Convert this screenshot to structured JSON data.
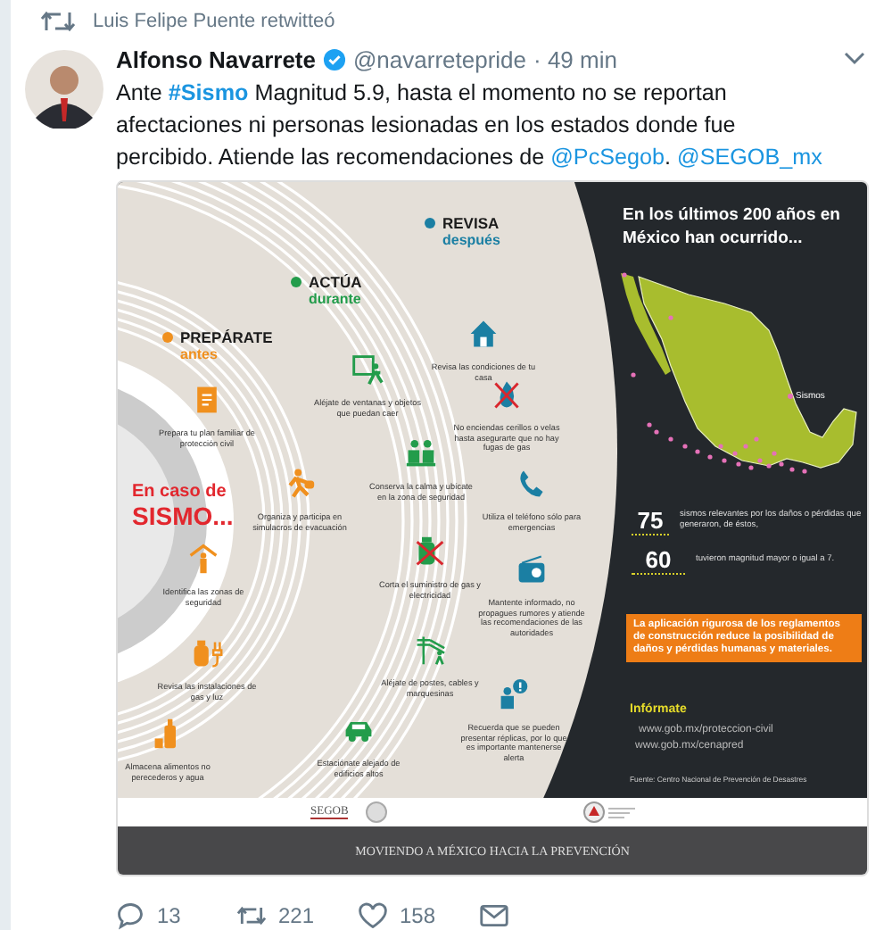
{
  "retweet_notice": "Luis Felipe Puente retwitteó",
  "tweet": {
    "author": "Alfonso Navarrete",
    "verified": true,
    "handle": "@navarretepride",
    "time": "· 49 min",
    "text": [
      {
        "kind": "plain",
        "text": "Ante "
      },
      {
        "kind": "hashtag",
        "text": "#Sismo"
      },
      {
        "kind": "plain",
        "text": " Magnitud 5.9, hasta el momento no se reportan afectaciones ni personas lesionadas en los estados donde fue percibido. Atiende las recomendaciones de "
      },
      {
        "kind": "mention",
        "text": "@PcSegob"
      },
      {
        "kind": "plain",
        "text": ". "
      },
      {
        "kind": "mention",
        "text": "@SEGOB_mx"
      }
    ]
  },
  "infographic": {
    "phases": [
      {
        "title": "PREPÁRATE",
        "subtitle": "antes",
        "color": "#f0901e"
      },
      {
        "title": "ACTÚA",
        "subtitle": "durante",
        "color": "#239c4b"
      },
      {
        "title": "REVISA",
        "subtitle": "después",
        "color": "#1b7fa3"
      }
    ],
    "headline": {
      "line_1": "En caso de",
      "line_2": "SISMO..."
    },
    "tips": [
      {
        "kind": "clipboard",
        "color": "#f0901e",
        "text": "Prepara tu plan familiar de protección civil"
      },
      {
        "kind": "runner",
        "color": "#f0901e",
        "text": "Organiza y participa en simulacros de evacuación"
      },
      {
        "kind": "shelter",
        "color": "#f0901e",
        "text": "Identifica las zonas de seguridad"
      },
      {
        "kind": "gas_plug",
        "color": "#f0901e",
        "text": "Revisa las instalaciones de gas y luz"
      },
      {
        "kind": "bottle",
        "color": "#f0901e",
        "text": "Almacena alimentos no perecederos y agua"
      },
      {
        "kind": "exit",
        "color": "#239c4b",
        "text": "Aléjate de ventanas y objetos que puedan caer"
      },
      {
        "kind": "people",
        "color": "#239c4b",
        "text": "Conserva la calma y ubícate en la zona de seguridad"
      },
      {
        "kind": "no_gas",
        "color": "#239c4b",
        "text": "Corta el suministro de gas y electricidad"
      },
      {
        "kind": "pole",
        "color": "#239c4b",
        "text": "Aléjate de postes, cables y marquesinas"
      },
      {
        "kind": "car",
        "color": "#239c4b",
        "text": "Estaciónate alejado de edificios altos"
      },
      {
        "kind": "house",
        "color": "#1b7fa3",
        "text": "Revisa las condiciones de tu casa"
      },
      {
        "kind": "no_fire",
        "color": "#1b7fa3",
        "text": "No enciendas cerillos o velas hasta asegurarte que no hay fugas de gas"
      },
      {
        "kind": "phone",
        "color": "#1b7fa3",
        "text": "Utiliza el teléfono sólo para emergencias"
      },
      {
        "kind": "radio",
        "color": "#1b7fa3",
        "text": "Mantente informado, no propagues rumores y atiende las recomendaciones de las autoridades"
      },
      {
        "kind": "alert",
        "color": "#1b7fa3",
        "text": "Recuerda que se pueden presentar réplicas, por lo que es importante mantenerse alerta"
      }
    ],
    "stats_title": "En los últimos 200 años en México han ocurrido...",
    "map_legend": "Sismos",
    "stats": [
      {
        "number": "75",
        "text": "sismos relevantes por los daños o pérdidas que generaron, de éstos,"
      },
      {
        "number": "60",
        "text": "tuvieron magnitud mayor o igual a 7."
      }
    ],
    "notice": "La aplicación rigurosa de los reglamentos de construcción reduce la posibilidad de daños y pérdidas humanas y materiales.",
    "info_title": "Infórmate",
    "links": [
      "www.gob.mx/proteccion-civil",
      "www.gob.mx/cenapred"
    ],
    "source": "Fuente: Centro Nacional de Prevención de Desastres",
    "logo_text": "SEGOB",
    "banner": "MOVIENDO A MÉXICO HACIA LA PREVENCIÓN"
  },
  "actions": [
    {
      "kind": "reply",
      "count": "13"
    },
    {
      "kind": "retweet",
      "count": "221"
    },
    {
      "kind": "like",
      "count": "158"
    },
    {
      "kind": "message"
    }
  ]
}
